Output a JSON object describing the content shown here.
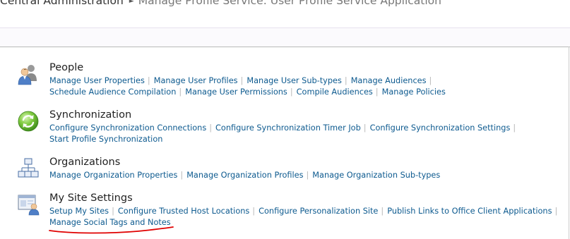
{
  "breadcrumb": {
    "root": "Central Administration",
    "current": "Manage Profile Service: User Profile Service Application"
  },
  "sections": {
    "people": {
      "title": "People",
      "icon": "people-icon",
      "links": [
        "Manage User Properties",
        "Manage User Profiles",
        "Manage User Sub-types",
        "Manage Audiences",
        "Schedule Audience Compilation",
        "Manage User Permissions",
        "Compile Audiences",
        "Manage Policies"
      ]
    },
    "synchronization": {
      "title": "Synchronization",
      "icon": "sync-icon",
      "links": [
        "Configure Synchronization Connections",
        "Configure Synchronization Timer Job",
        "Configure Synchronization Settings",
        "Start Profile Synchronization"
      ]
    },
    "organizations": {
      "title": "Organizations",
      "icon": "org-chart-icon",
      "links": [
        "Manage Organization Properties",
        "Manage Organization Profiles",
        "Manage Organization Sub-types"
      ]
    },
    "mysite": {
      "title": "My Site Settings",
      "icon": "my-site-icon",
      "links": [
        "Setup My Sites",
        "Configure Trusted Host Locations",
        "Configure Personalization Site",
        "Publish Links to Office Client Applications",
        "Manage Social Tags and Notes"
      ]
    }
  },
  "annotation": {
    "color": "#e00000",
    "target": "Manage Social Tags and Notes"
  },
  "colors": {
    "link": "#0d5a8f",
    "title": "#222222",
    "band": "#fbfafd"
  }
}
